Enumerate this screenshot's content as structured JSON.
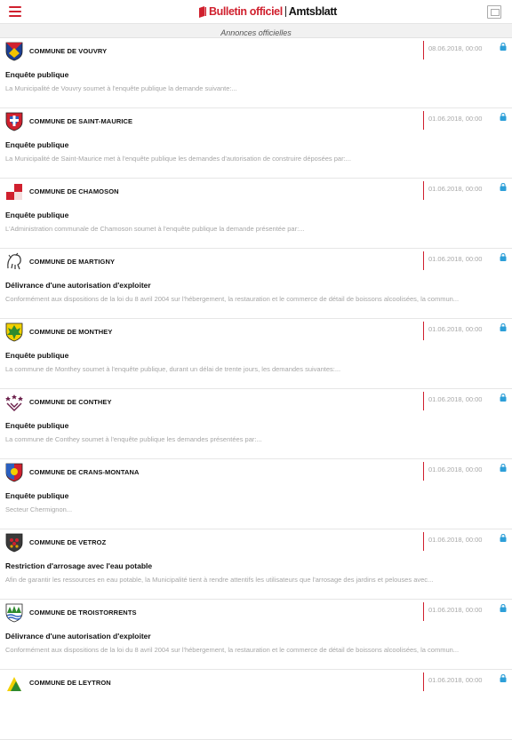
{
  "header": {
    "brand_primary": "Bulletin officiel",
    "brand_secondary": "Amtsblatt",
    "section_title": "Annonces officielles"
  },
  "colors": {
    "accent": "#d0202e",
    "muted_text": "#a8a8a8",
    "divider": "#e6e6e6"
  },
  "items": [
    {
      "commune": "COMMUNE DE VOUVRY",
      "date": "08.06.2018, 00:00",
      "title": "Enquête publique",
      "snippet": "La Municipalité de Vouvry soumet à l'enquête publique la demande suivante:..."
    },
    {
      "commune": "COMMUNE DE SAINT-MAURICE",
      "date": "01.06.2018, 00:00",
      "title": "Enquête publique",
      "snippet": "La Municipalité de Saint-Maurice met à l'enquête publique les demandes d'autorisation de construire déposées par:..."
    },
    {
      "commune": "COMMUNE DE CHAMOSON",
      "date": "01.06.2018, 00:00",
      "title": "Enquête publique",
      "snippet": "L'Administration communale de Chamoson soumet à l'enquête publique la demande présentée par:..."
    },
    {
      "commune": "COMMUNE DE MARTIGNY",
      "date": "01.06.2018, 00:00",
      "title": "Délivrance d'une autorisation d'exploiter",
      "snippet": "Conformément aux dispositions de la loi du 8 avril 2004 sur l'hébergement, la restauration et le commerce de détail de boissons alcoolisées, la commun..."
    },
    {
      "commune": "COMMUNE DE MONTHEY",
      "date": "01.06.2018, 00:00",
      "title": "Enquête publique",
      "snippet": "La commune de Monthey soumet à l'enquête publique, durant un délai de trente jours, les demandes suivantes:..."
    },
    {
      "commune": "COMMUNE DE CONTHEY",
      "date": "01.06.2018, 00:00",
      "title": "Enquête publique",
      "snippet": "La commune de Conthey soumet à l'enquête publique les demandes présentées par:..."
    },
    {
      "commune": "COMMUNE DE CRANS-MONTANA",
      "date": "01.06.2018, 00:00",
      "title": "Enquête publique",
      "snippet": "Secteur Chermignon..."
    },
    {
      "commune": "COMMUNE DE VETROZ",
      "date": "01.06.2018, 00:00",
      "title": "Restriction d'arrosage avec l'eau potable",
      "snippet": "Afin de garantir les ressources en eau potable, la Municipalité tient à rendre attentifs les utilisateurs que l'arrosage des jardins et pelouses avec..."
    },
    {
      "commune": "COMMUNE DE TROISTORRENTS",
      "date": "01.06.2018, 00:00",
      "title": "Délivrance d'une autorisation d'exploiter",
      "snippet": "Conformément aux dispositions de la loi du 8 avril 2004 sur l'hébergement, la restauration et le commerce de détail de boissons alcoolisées, la commun..."
    },
    {
      "commune": "COMMUNE DE LEYTRON",
      "date": "01.06.2018, 00:00",
      "title": "",
      "snippet": ""
    }
  ]
}
